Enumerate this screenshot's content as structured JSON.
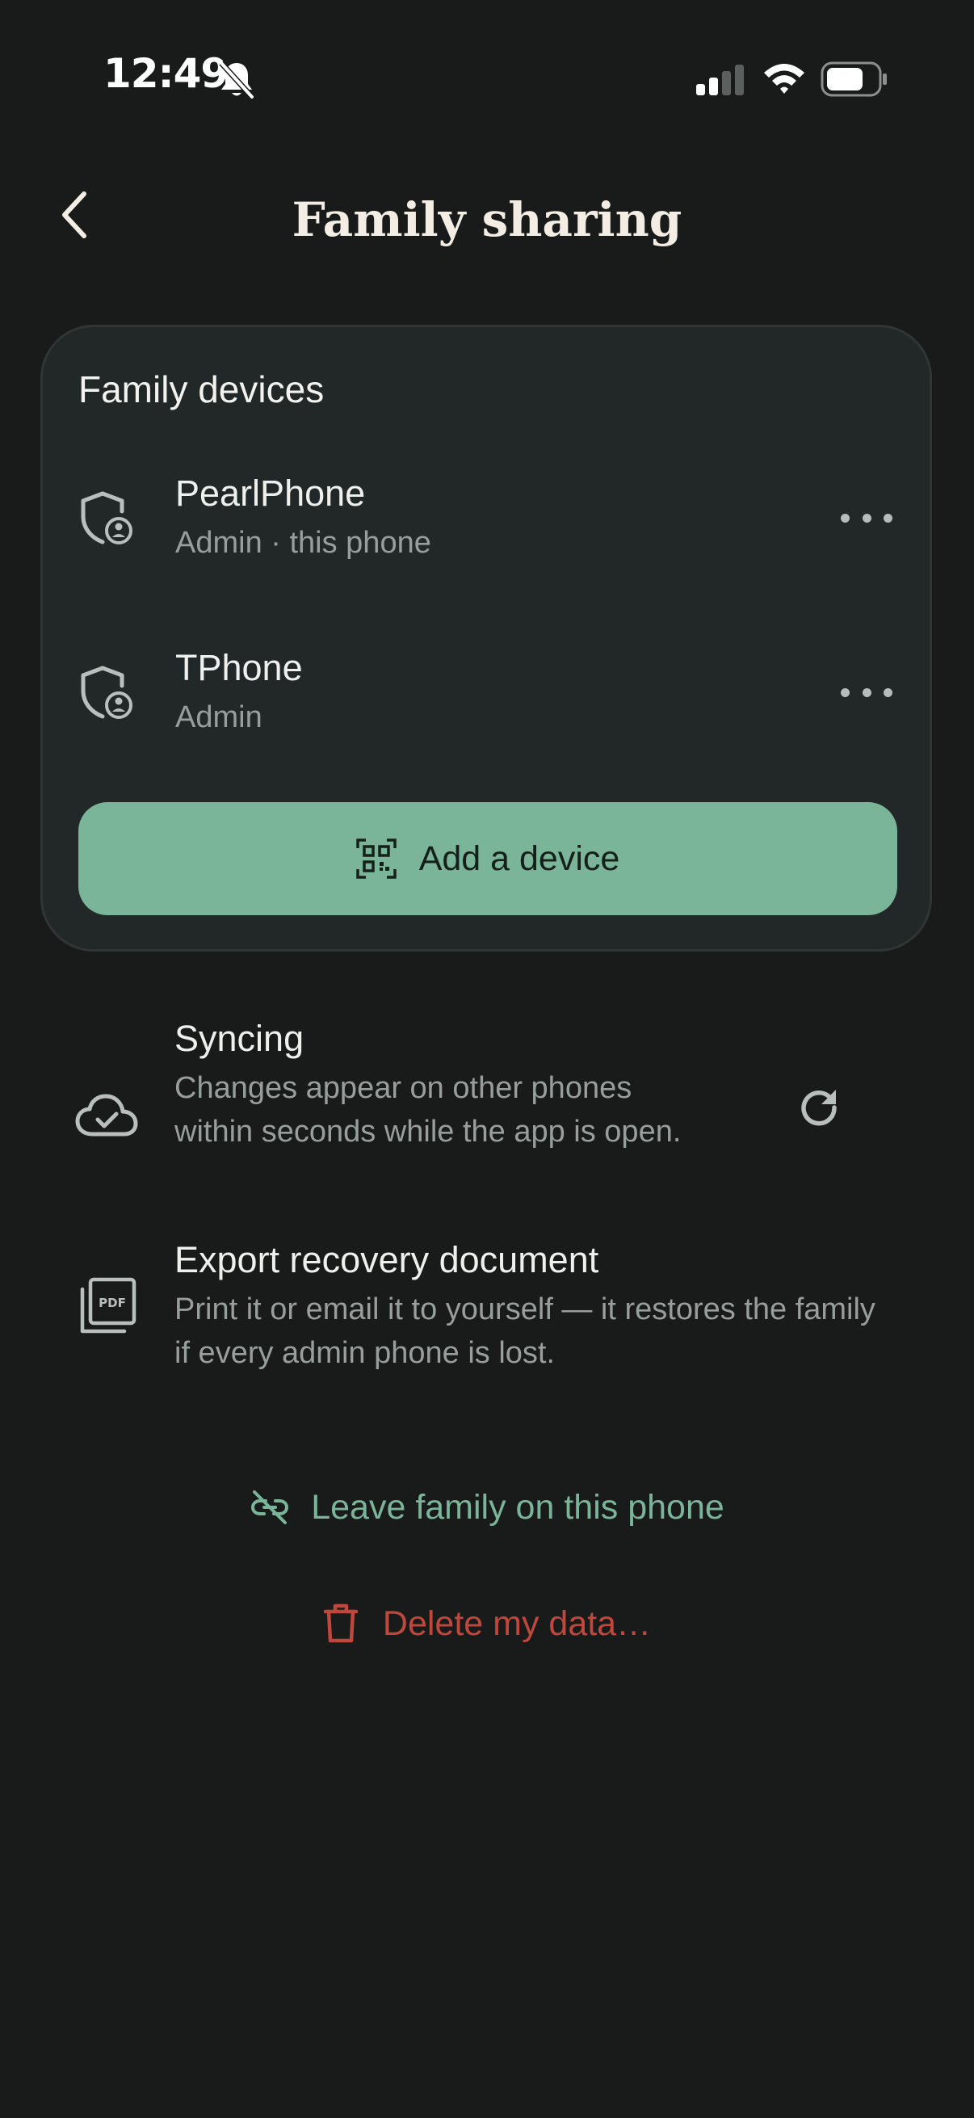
{
  "status_bar": {
    "time": "12:49",
    "icons": [
      "bell-slash-icon",
      "cellular-signal-icon",
      "wifi-icon",
      "battery-icon"
    ]
  },
  "header": {
    "title": "Family sharing",
    "back_icon": "chevron-left-icon"
  },
  "devices_card": {
    "title": "Family devices",
    "devices": [
      {
        "name": "PearlPhone",
        "subtitle": "Admin · this phone",
        "icon": "shield-user-icon",
        "menu_icon": "more-horizontal-icon"
      },
      {
        "name": "TPhone",
        "subtitle": "Admin",
        "icon": "shield-user-icon",
        "menu_icon": "more-horizontal-icon"
      }
    ],
    "add_button": {
      "label": "Add a device",
      "icon": "qr-code-icon"
    }
  },
  "settings": {
    "syncing": {
      "title": "Syncing",
      "description": "Changes appear on other phones within seconds while the app is open.",
      "icon": "cloud-check-icon",
      "action_icon": "refresh-icon"
    },
    "export": {
      "title": "Export recovery document",
      "description": "Print it or email it to yourself — it restores the family if every admin phone is lost.",
      "icon": "pdf-document-icon"
    }
  },
  "actions": {
    "leave": {
      "label": "Leave family on this phone",
      "icon": "unlink-icon"
    },
    "delete": {
      "label": "Delete my data…",
      "icon": "trash-icon"
    }
  },
  "colors": {
    "background": "#181b1a",
    "card": "#222827",
    "accent": "#7ab59a",
    "danger": "#c0473c",
    "muted_text": "#979e9b"
  }
}
